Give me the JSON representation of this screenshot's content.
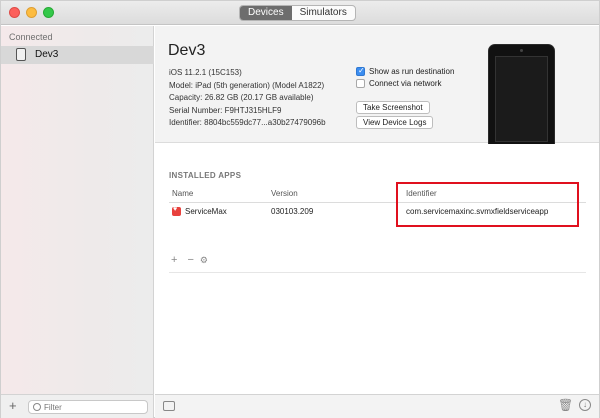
{
  "window": {
    "tabs": [
      {
        "label": "Devices",
        "active": true
      },
      {
        "label": "Simulators",
        "active": false
      }
    ]
  },
  "sidebar": {
    "heading": "Connected",
    "items": [
      {
        "label": "Dev3",
        "icon": "ipad-icon",
        "selected": true
      }
    ],
    "filter_placeholder": "Filter"
  },
  "device": {
    "name": "Dev3",
    "info": [
      "iOS 11.2.1 (15C153)",
      "Model: iPad (5th generation) (Model A1822)",
      "Capacity: 26.82 GB (20.17 GB available)",
      "Serial Number: F9HTJ315HLF9",
      "Identifier: 8804bc559dc77...a30b27479096b"
    ],
    "options": {
      "show_run_destination": {
        "label": "Show as run destination",
        "checked": true
      },
      "connect_via_network": {
        "label": "Connect via network",
        "checked": false
      }
    },
    "buttons": {
      "screenshot": "Take Screenshot",
      "logs": "View Device Logs"
    }
  },
  "installed_apps": {
    "title": "INSTALLED APPS",
    "columns": [
      "Name",
      "Version",
      "Identifier"
    ],
    "rows": [
      {
        "name": "ServiceMax",
        "version": "030103.209",
        "identifier": "com.servicemaxinc.svmxfieldserviceapp"
      }
    ]
  },
  "colors": {
    "highlight_box": "#e0101e",
    "checkbox_accent": "#3b8df0"
  }
}
